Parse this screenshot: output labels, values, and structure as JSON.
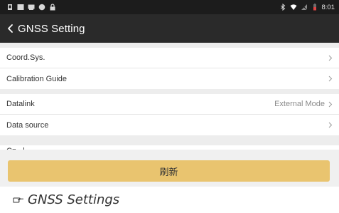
{
  "status_bar": {
    "time": "8:01",
    "left_icons": [
      "notification-icon",
      "image-icon",
      "message-icon",
      "circle-app-icon",
      "lock-icon"
    ],
    "right_icons": [
      "bluetooth-icon",
      "wifi-icon",
      "no-sim-icon",
      "battery-icon"
    ]
  },
  "app_bar": {
    "back_icon": "chevron-left-icon",
    "title": "GNSS Setting"
  },
  "settings": {
    "group1": [
      {
        "label": "Coord.Sys.",
        "value": ""
      },
      {
        "label": "Calibration Guide",
        "value": ""
      }
    ],
    "group2": [
      {
        "label": "Datalink",
        "value": "External Mode"
      },
      {
        "label": "Data source",
        "value": ""
      }
    ],
    "partial": {
      "label": "Cn...l...",
      "value": "..."
    }
  },
  "refresh_button": {
    "label": "刷新"
  },
  "caption": {
    "icon": "pointing-hand-icon",
    "text": "GNSS Settings"
  },
  "colors": {
    "status_bar": "#1c1c1c",
    "app_bar": "#2a2a2a",
    "content_bg": "#ededed",
    "button": "#e9c46f"
  }
}
